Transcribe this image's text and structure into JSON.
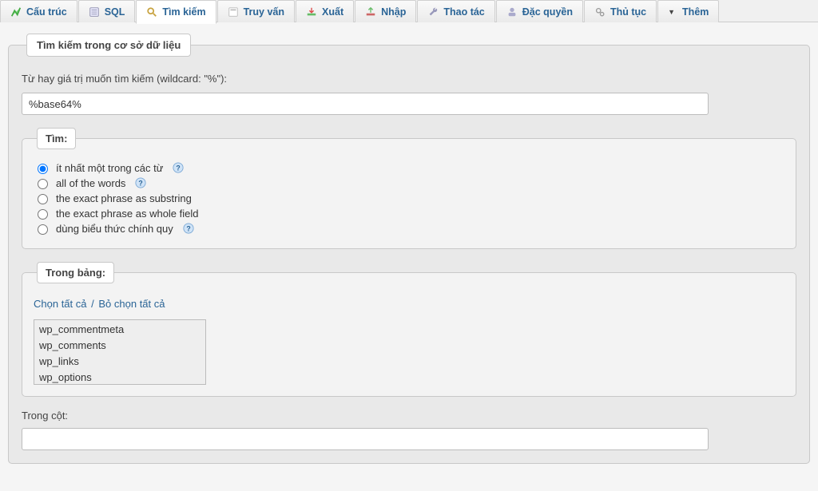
{
  "tabs": [
    {
      "label": "Cấu trúc",
      "icon": "structure"
    },
    {
      "label": "SQL",
      "icon": "sql"
    },
    {
      "label": "Tìm kiếm",
      "icon": "search",
      "active": true
    },
    {
      "label": "Truy vấn",
      "icon": "query"
    },
    {
      "label": "Xuất",
      "icon": "export"
    },
    {
      "label": "Nhập",
      "icon": "import"
    },
    {
      "label": "Thao tác",
      "icon": "operations"
    },
    {
      "label": "Đặc quyền",
      "icon": "privileges"
    },
    {
      "label": "Thủ tục",
      "icon": "routines"
    },
    {
      "label": "Thêm",
      "icon": "more"
    }
  ],
  "panel": {
    "legend": "Tìm kiếm trong cơ sở dữ liệu",
    "search_label": "Từ hay giá trị muốn tìm kiếm (wildcard: \"%\"):",
    "search_value": "%base64%"
  },
  "find": {
    "legend": "Tìm:",
    "options": [
      {
        "label": "ít nhất một trong các từ",
        "help": true,
        "checked": true
      },
      {
        "label": "all of the words",
        "help": true,
        "checked": false
      },
      {
        "label": "the exact phrase as substring",
        "help": false,
        "checked": false
      },
      {
        "label": "the exact phrase as whole field",
        "help": false,
        "checked": false
      },
      {
        "label": "dùng biểu thức chính quy",
        "help": true,
        "checked": false
      }
    ]
  },
  "tables": {
    "legend": "Trong bảng:",
    "select_all": "Chọn tất cả",
    "separator": "/",
    "unselect_all": "Bỏ chọn tất cả",
    "items": [
      "wp_commentmeta",
      "wp_comments",
      "wp_links",
      "wp_options"
    ]
  },
  "column": {
    "label": "Trong cột:",
    "value": ""
  }
}
